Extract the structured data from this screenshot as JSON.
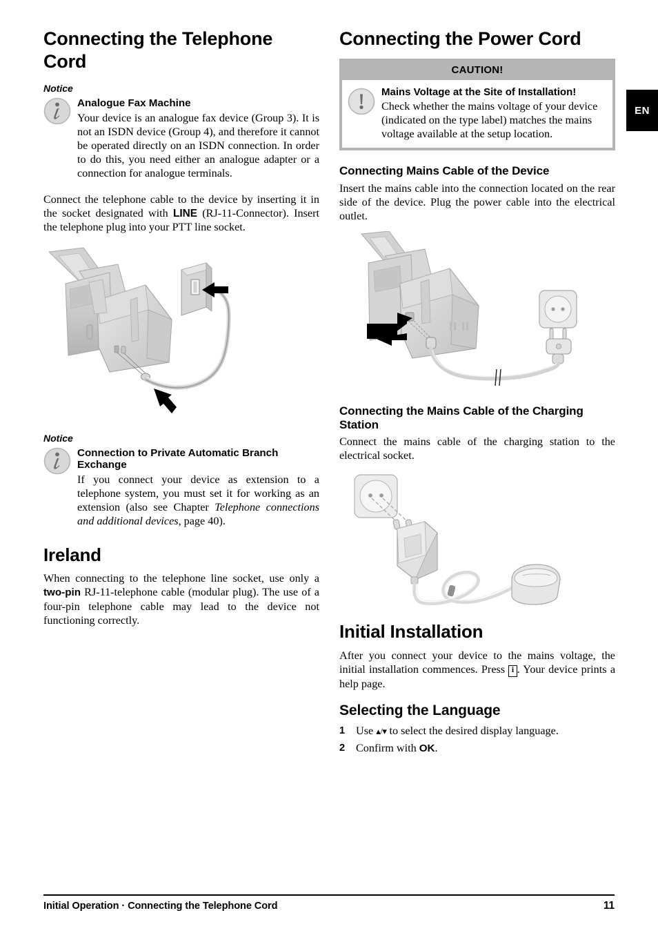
{
  "language_tab": "EN",
  "left_column": {
    "chapter_title": "Connecting the Telephone Cord",
    "notice1": {
      "label": "Notice",
      "icon": "info-icon",
      "title": "Analogue Fax Machine",
      "text": "Your device is an analogue fax device (Group 3). It is not an ISDN device (Group 4), and therefore it cannot be operated directly on an ISDN connection. In order to do this, you need either an analogue adapter or a connection for analogue terminals."
    },
    "paragraph1_part1": "Connect the telephone cable to the device by inserting it in the socket designated with ",
    "paragraph1_bold": "LINE",
    "paragraph1_part2": " (RJ-11-Connector). Insert the telephone plug into your PTT line socket.",
    "figure1_alt": "Fax machine with telephone cable plugged into wall line socket",
    "notice2": {
      "label": "Notice",
      "icon": "info-icon",
      "title": "Connection to Private Automatic Branch Exchange",
      "text_part1": "If you connect your device as extension to a telephone system, you must set it for working as an extension (also see Chapter ",
      "text_italic": "Telephone connections and additional devices",
      "text_part2": ", page 40)."
    },
    "section_ireland": {
      "heading": "Ireland",
      "text_part1": "When connecting to the telephone line socket, use only a ",
      "text_bold": "two-pin",
      "text_part2": " RJ-11-telephone cable (modular plug). The use of a four-pin telephone cable may lead to the device not functioning correctly."
    }
  },
  "right_column": {
    "chapter_title": "Connecting the Power Cord",
    "caution": {
      "header": "CAUTION!",
      "icon": "warning-icon",
      "title": "Mains Voltage at the Site of Installation!",
      "text": "Check whether the mains voltage of your device (indicated on the type label) matches the mains voltage available at the setup location."
    },
    "section_mains_device": {
      "heading": "Connecting Mains Cable of the Device",
      "text": "Insert the mains cable into the connection located on the rear side of the device. Plug the power cable into the electrical outlet."
    },
    "figure2_alt": "Fax machine rear with mains cable plugged into electrical wall outlet",
    "section_charging": {
      "heading": "Connecting the Mains Cable of the Charging Station",
      "text": "Connect the mains cable of the charging station to the electrical socket."
    },
    "figure3_alt": "Power adapter plugged into wall socket connected to charging station cradle",
    "section_initial": {
      "heading": "Initial Installation",
      "text_part1": "After you connect your device to the mains voltage, the initial installation commences. Press ",
      "key_symbol": "i",
      "text_part2": ". Your device prints a help page."
    },
    "section_language": {
      "heading": "Selecting the Language",
      "steps": [
        {
          "num": "1",
          "text_part1": "Use ",
          "glyph": "▴/▾",
          "text_part2": " to select the desired display language."
        },
        {
          "num": "2",
          "text_part1": "Confirm with ",
          "bold": "OK",
          "text_part2": "."
        }
      ]
    }
  },
  "footer": {
    "chapter": "Initial Operation",
    "separator": "·",
    "section": "Connecting the Telephone Cord",
    "page_number": "11"
  },
  "colors": {
    "caution_band": "#b5b5b5",
    "icon_gray": "#c9c9c9",
    "illustration_gray": "#d3d3d3",
    "text": "#000000"
  }
}
